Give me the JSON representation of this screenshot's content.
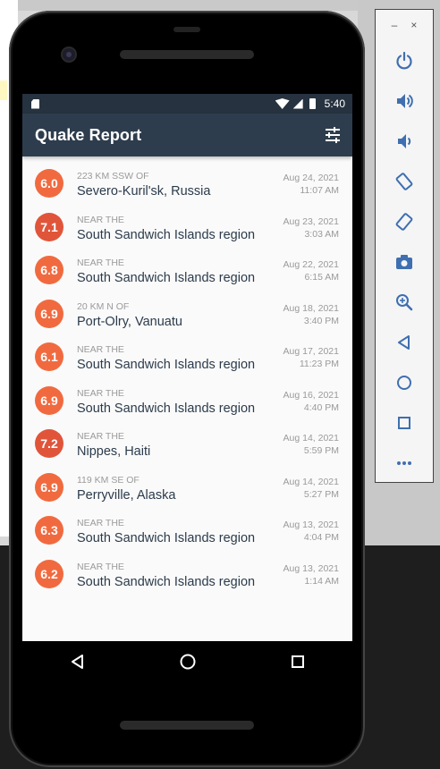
{
  "app": {
    "title": "Quake Report"
  },
  "status_bar": {
    "time": "5:40"
  },
  "earthquakes": [
    {
      "magnitude": "6.0",
      "offset": "223 KM SSW OF",
      "place": "Severo-Kuril'sk, Russia",
      "date": "Aug 24, 2021",
      "time": "11:07 AM",
      "color": "#f16a3f"
    },
    {
      "magnitude": "7.1",
      "offset": "NEAR THE",
      "place": "South Sandwich Islands region",
      "date": "Aug 23, 2021",
      "time": "3:03 AM",
      "color": "#e0553a"
    },
    {
      "magnitude": "6.8",
      "offset": "NEAR THE",
      "place": "South Sandwich Islands region",
      "date": "Aug 22, 2021",
      "time": "6:15 AM",
      "color": "#f16a3f"
    },
    {
      "magnitude": "6.9",
      "offset": "20 KM N OF",
      "place": "Port-Olry, Vanuatu",
      "date": "Aug 18, 2021",
      "time": "3:40 PM",
      "color": "#f16a3f"
    },
    {
      "magnitude": "6.1",
      "offset": "NEAR THE",
      "place": "South Sandwich Islands region",
      "date": "Aug 17, 2021",
      "time": "11:23 PM",
      "color": "#f16a3f"
    },
    {
      "magnitude": "6.9",
      "offset": "NEAR THE",
      "place": "South Sandwich Islands region",
      "date": "Aug 16, 2021",
      "time": "4:40 PM",
      "color": "#f16a3f"
    },
    {
      "magnitude": "7.2",
      "offset": "NEAR THE",
      "place": "Nippes, Haiti",
      "date": "Aug 14, 2021",
      "time": "5:59 PM",
      "color": "#e0553a"
    },
    {
      "magnitude": "6.9",
      "offset": "119 KM SE OF",
      "place": "Perryville, Alaska",
      "date": "Aug 14, 2021",
      "time": "5:27 PM",
      "color": "#f16a3f"
    },
    {
      "magnitude": "6.3",
      "offset": "NEAR THE",
      "place": "South Sandwich Islands region",
      "date": "Aug 13, 2021",
      "time": "4:04 PM",
      "color": "#f16a3f"
    },
    {
      "magnitude": "6.2",
      "offset": "NEAR THE",
      "place": "South Sandwich Islands region",
      "date": "Aug 13, 2021",
      "time": "1:14 AM",
      "color": "#f16a3f"
    }
  ],
  "emulator_toolbar": {
    "minimize": "–",
    "close": "×",
    "buttons": [
      "power-icon",
      "volume-up-icon",
      "volume-down-icon",
      "rotate-left-icon",
      "rotate-right-icon",
      "camera-icon",
      "zoom-icon",
      "back-icon",
      "home-icon",
      "overview-icon",
      "more-icon"
    ]
  },
  "colors": {
    "appbar": "#2e3d4d",
    "statusbar": "#26323f",
    "list_background": "#fafafa",
    "toolbar_icon": "#3f6fb0"
  }
}
